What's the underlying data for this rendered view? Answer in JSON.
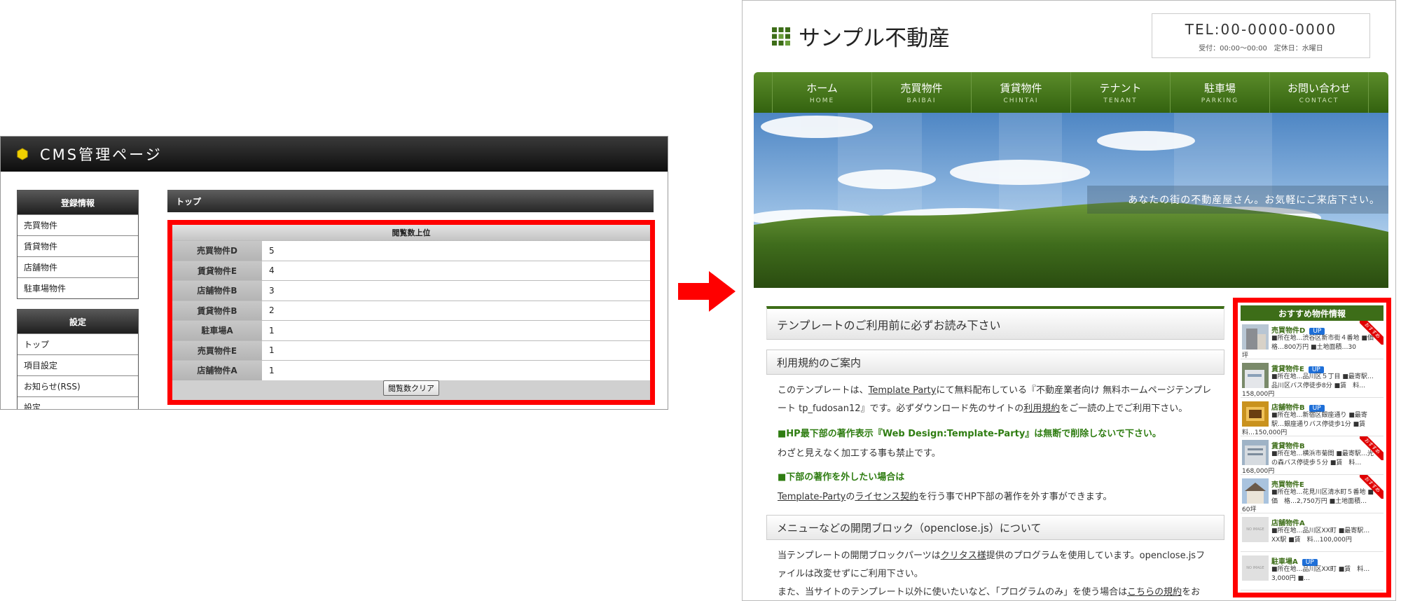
{
  "cms": {
    "title": "CMS管理ページ",
    "sidebar": {
      "registration_head": "登録情報",
      "registration_items": [
        "売買物件",
        "賃貸物件",
        "店舗物件",
        "駐車場物件"
      ],
      "settings_head": "設定",
      "settings_items": [
        "トップ",
        "項目設定",
        "お知らせ(RSS)",
        "設定"
      ]
    },
    "main": {
      "section_title": "トップ",
      "ranking_title": "閲覧数上位",
      "ranking": [
        {
          "name": "売買物件D",
          "views": "5"
        },
        {
          "name": "賃貸物件E",
          "views": "4"
        },
        {
          "name": "店舗物件B",
          "views": "3"
        },
        {
          "name": "賃貸物件B",
          "views": "2"
        },
        {
          "name": "駐車場A",
          "views": "1"
        },
        {
          "name": "売買物件E",
          "views": "1"
        },
        {
          "name": "店舗物件A",
          "views": "1"
        }
      ],
      "clear_button": "閲覧数クリア"
    }
  },
  "site": {
    "brand": "サンプル不動産",
    "tel": "TEL:00-0000-0000",
    "hours": "受付：00:00〜00:00　定休日：水曜日",
    "nav": [
      {
        "ja": "ホーム",
        "en": "HOME"
      },
      {
        "ja": "売買物件",
        "en": "BAIBAI"
      },
      {
        "ja": "賃貸物件",
        "en": "CHINTAI"
      },
      {
        "ja": "テナント",
        "en": "TENANT"
      },
      {
        "ja": "駐車場",
        "en": "PARKING"
      },
      {
        "ja": "お問い合わせ",
        "en": "CONTACT"
      }
    ],
    "hero_caption": "あなたの街の不動産屋さん。お気軽にご来店下さい。",
    "content": {
      "h2": "テンプレートのご利用前に必ずお読み下さい",
      "h3_terms": "利用規約のご案内",
      "terms_p1_a": "このテンプレートは、",
      "terms_link1": "Template Party",
      "terms_p1_b": "にて無料配布している『不動産業者向け 無料ホームページテンプレート tp_fudosan12』です。必ずダウンロード先のサイトの",
      "terms_link2": "利用規約",
      "terms_p1_c": "をご一読の上でご利用下さい。",
      "note1": "■HP最下部の著作表示『Web Design:Template-Party』は無断で削除しないで下さい。",
      "note1_sub": "わざと見えなく加工する事も禁止です。",
      "note2": "■下部の著作を外したい場合は",
      "note2_link1": "Template-Party",
      "note2_mid": "の",
      "note2_link2": "ライセンス契約",
      "note2_tail": "を行う事でHP下部の著作を外す事ができます。",
      "h3_menu": "メニューなどの開閉ブロック（openclose.js）について",
      "menu_p1_a": "当テンプレートの開閉ブロックパーツは",
      "menu_link1": "クリタス様",
      "menu_p1_b": "提供のプログラムを使用しています。openclose.jsファイルは改変せずにご利用下さい。",
      "menu_p2_a": "また、当サイトのテンプレート以外に使いたいなど、「プログラムのみ」を使う場合は",
      "menu_link2": "こちらの規約",
      "menu_p2_b": "をお"
    },
    "recommend": {
      "title": "おすすめ物件情報",
      "up_label": "UP",
      "ribbon_label": "おすすめ",
      "noimage_label": "NO IMAGE",
      "items": [
        {
          "name": "売買物件D",
          "desc": "■所在地…渋谷区新市街４番地 ■価　格…800万円 ■土地面積…30",
          "tail": "坪"
        },
        {
          "name": "賃貸物件E",
          "desc": "■所在地…品川区５丁目 ■最寄駅…品川区バス停徒歩8分 ■賃　料…",
          "tail": "158,000円"
        },
        {
          "name": "店舗物件B",
          "desc": "■所在地…新宿区銀座通り ■最寄駅…銀座通りバス停徒歩1分 ■賃　",
          "tail": "料…150,000円"
        },
        {
          "name": "賃貸物件B",
          "desc": "■所在地…横浜市菊間 ■最寄駅…光の森バス停徒歩５分 ■賃　料…",
          "tail": "168,000円"
        },
        {
          "name": "売買物件E",
          "desc": "■所在地…花見川区清水町５番地 ■価　格…2,750万円 ■土地面積…",
          "tail": "60坪"
        },
        {
          "name": "店舗物件A",
          "desc": "■所在地…品川区XX町 ■最寄駅…XX駅 ■賃　料…100,000円",
          "tail": ""
        },
        {
          "name": "駐車場A",
          "desc": "■所在地…品川区XX町 ■賃　料…3,000円 ■…",
          "tail": ""
        }
      ]
    }
  }
}
